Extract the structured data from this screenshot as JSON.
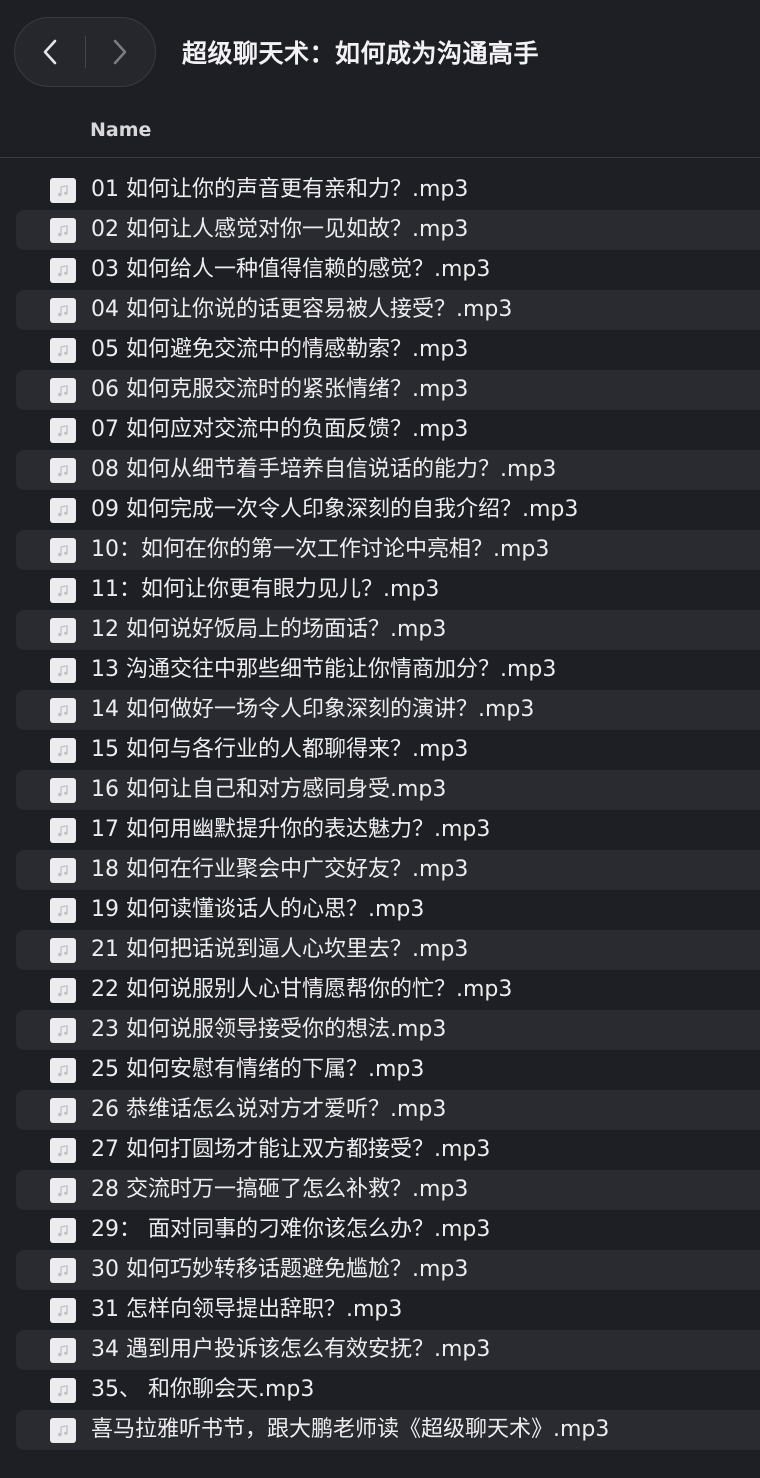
{
  "window": {
    "title": "超级聊天术：如何成为沟通高手"
  },
  "columns": {
    "name_header": "Name"
  },
  "files": [
    "01  如何让你的声音更有亲和力？.mp3",
    "02  如何让人感觉对你一见如故？.mp3",
    "03  如何给人一种值得信赖的感觉？.mp3",
    "04  如何让你说的话更容易被人接受？.mp3",
    "05  如何避免交流中的情感勒索？.mp3",
    "06  如何克服交流时的紧张情绪？.mp3",
    "07  如何应对交流中的负面反馈？.mp3",
    "08  如何从细节着手培养自信说话的能力？.mp3",
    "09  如何完成一次令人印象深刻的自我介绍？.mp3",
    "10：如何在你的第一次工作讨论中亮相？.mp3",
    "11：如何让你更有眼力见儿？.mp3",
    "12  如何说好饭局上的场面话？.mp3",
    "13  沟通交往中那些细节能让你情商加分？.mp3",
    "14  如何做好一场令人印象深刻的演讲？.mp3",
    "15  如何与各行业的人都聊得来？.mp3",
    "16  如何让自己和对方感同身受.mp3",
    "17  如何用幽默提升你的表达魅力？.mp3",
    "18  如何在行业聚会中广交好友？.mp3",
    "19  如何读懂谈话人的心思？.mp3",
    "21  如何把话说到逼人心坎里去？.mp3",
    "22 如何说服别人心甘情愿帮你的忙？.mp3",
    "23 如何说服领导接受你的想法.mp3",
    "25  如何安慰有情绪的下属？.mp3",
    "26  恭维话怎么说对方才爱听？.mp3",
    "27  如何打圆场才能让双方都接受？.mp3",
    "28  交流时万一搞砸了怎么补救？.mp3",
    "29：  面对同事的刁难你该怎么办？.mp3",
    "30  如何巧妙转移话题避免尴尬？.mp3",
    "31  怎样向领导提出辞职？.mp3",
    "34  遇到用户投诉该怎么有效安抚？.mp3",
    "35、 和你聊会天.mp3",
    "喜马拉雅听书节，跟大鹏老师读《超级聊天术》.mp3"
  ],
  "icons": {
    "back": "chevron-left-icon",
    "forward": "chevron-right-icon",
    "file": "audio-file-icon"
  },
  "colors": {
    "background": "#1e1f24",
    "row_alt": "#2a2b30",
    "text": "#ededf0"
  }
}
